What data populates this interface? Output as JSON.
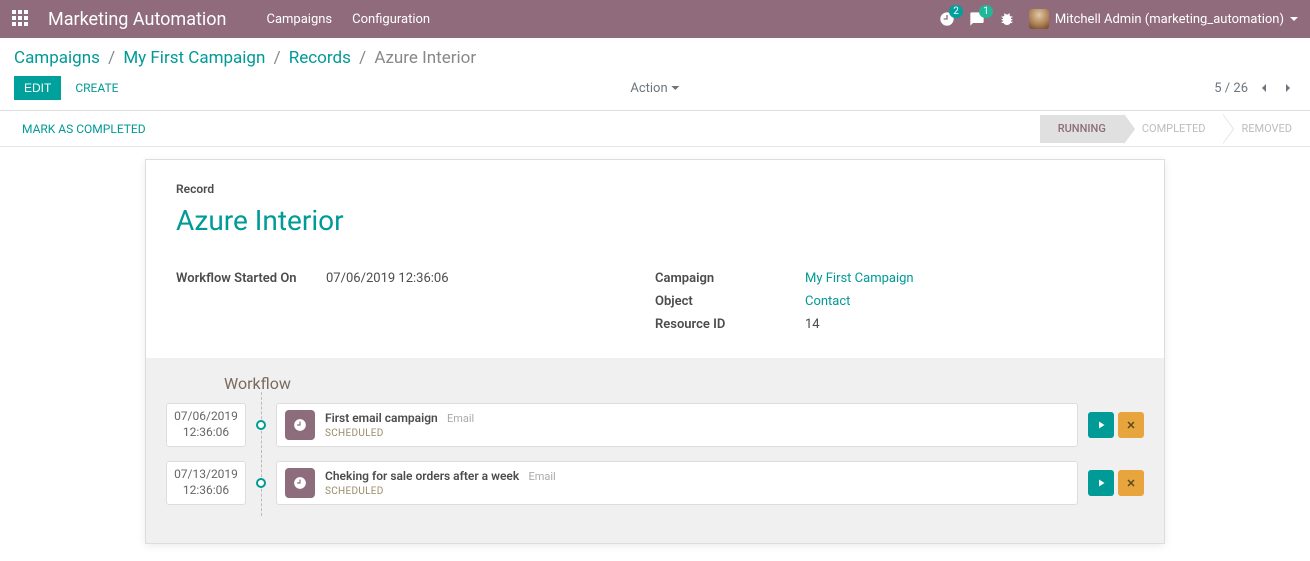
{
  "navbar": {
    "brand": "Marketing Automation",
    "links": {
      "campaigns": "Campaigns",
      "configuration": "Configuration"
    },
    "clock_badge": "2",
    "chat_badge": "1",
    "user": "Mitchell Admin (marketing_automation)"
  },
  "breadcrumbs": {
    "campaigns": "Campaigns",
    "my_first_campaign": "My First Campaign",
    "records": "Records",
    "current": "Azure Interior"
  },
  "toolbar": {
    "edit": "EDIT",
    "create": "CREATE",
    "action": "Action",
    "pager": "5 / 26"
  },
  "statusbar": {
    "mark_completed": "MARK AS COMPLETED",
    "running": "RUNNING",
    "completed": "COMPLETED",
    "removed": "REMOVED"
  },
  "record": {
    "label": "Record",
    "name": "Azure Interior"
  },
  "details": {
    "workflow_started_label": "Workflow Started On",
    "workflow_started_value": "07/06/2019 12:36:06",
    "campaign_label": "Campaign",
    "campaign_value": "My First Campaign",
    "object_label": "Object",
    "object_value": "Contact",
    "resource_id_label": "Resource ID",
    "resource_id_value": "14"
  },
  "workflow": {
    "title": "Workflow",
    "items": [
      {
        "date": "07/06/2019",
        "time": "12:36:06",
        "title": "First email campaign",
        "type": "Email",
        "status": "SCHEDULED"
      },
      {
        "date": "07/13/2019",
        "time": "12:36:06",
        "title": "Cheking for sale orders after a week",
        "type": "Email",
        "status": "SCHEDULED"
      }
    ]
  }
}
